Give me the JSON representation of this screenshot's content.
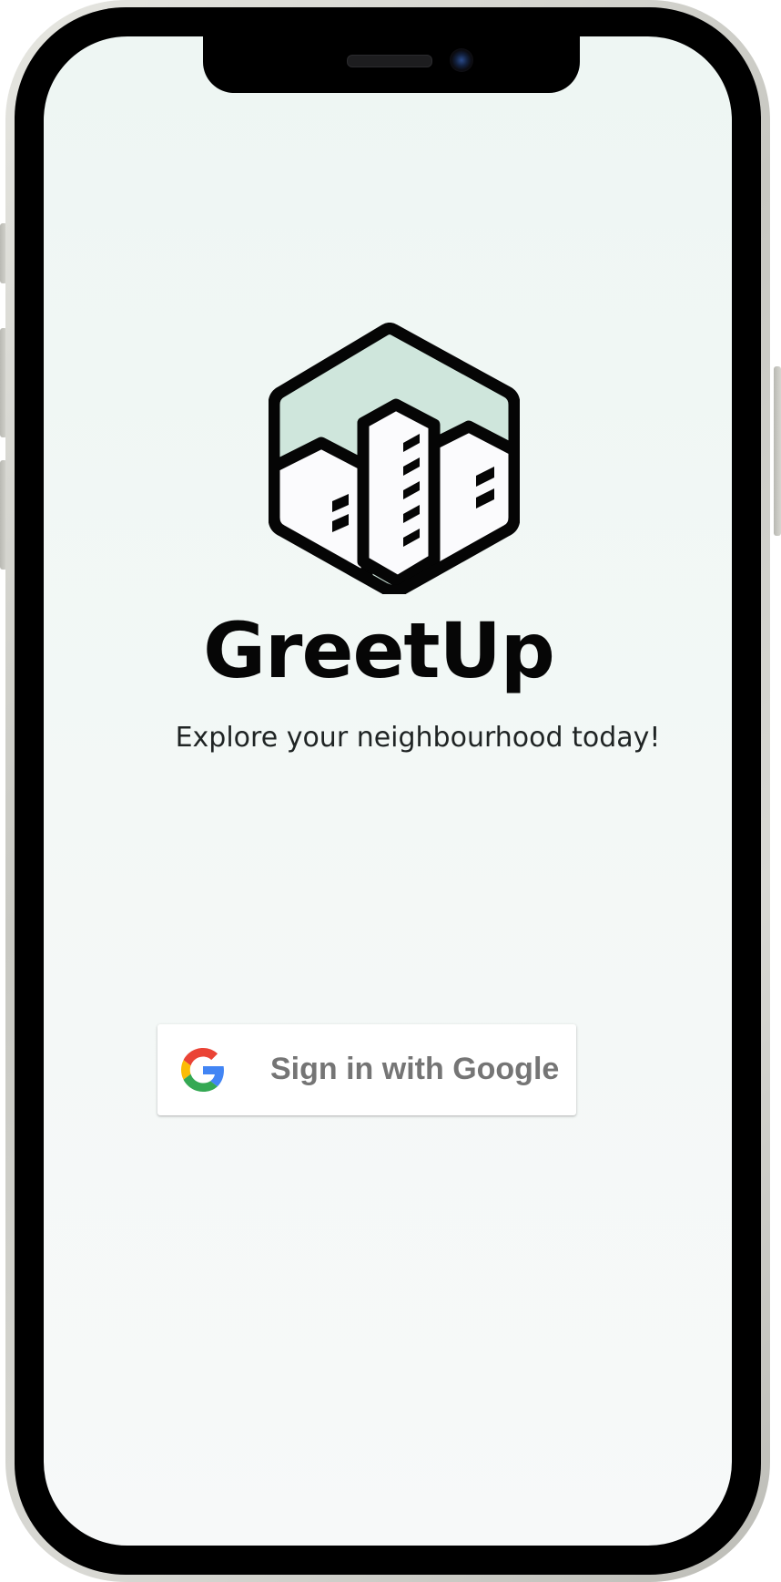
{
  "app": {
    "name": "GreetUp",
    "tagline": "Explore your neighbourhood today!"
  },
  "signin": {
    "label": "Sign in with Google",
    "icon": "google-g-icon"
  },
  "icons": {
    "logo": "greetup-buildings-hexagon-logo"
  },
  "colors": {
    "screen_background": "#f1f7f5",
    "logo_sky": "#cfe6dc",
    "logo_outline": "#050505",
    "brand_text": "#060606",
    "tagline_text": "#1f2424",
    "button_text": "#757575",
    "google_blue": "#4285F4",
    "google_red": "#EA4335",
    "google_yellow": "#FBBC05",
    "google_green": "#34A853"
  }
}
